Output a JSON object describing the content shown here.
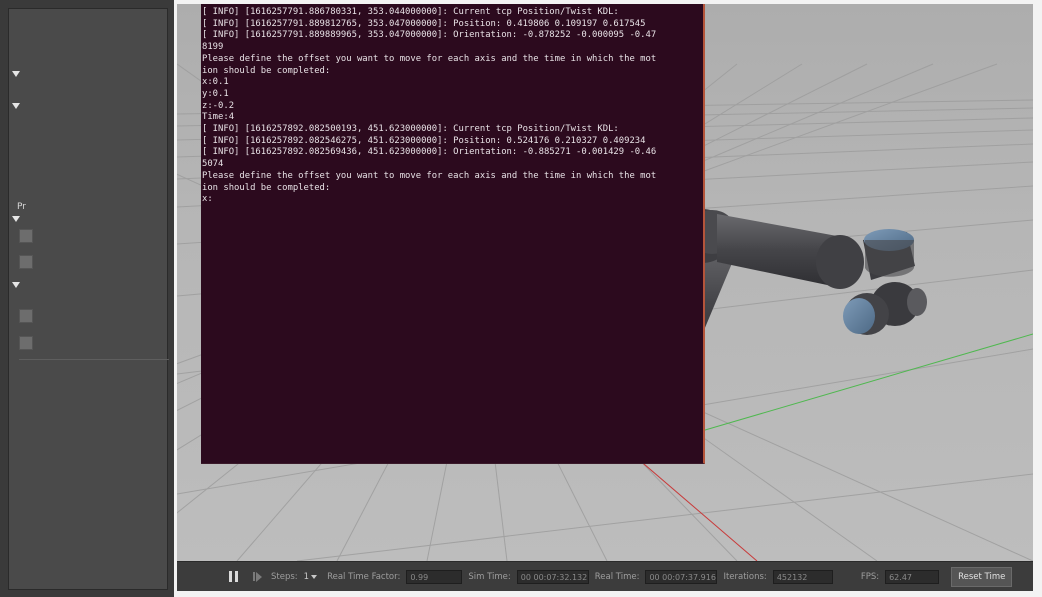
{
  "terminal": {
    "lines": [
      "[ INFO] [1616257791.886780331, 353.044000000]: Current tcp Position/Twist KDL:",
      "[ INFO] [1616257791.889812765, 353.047000000]: Position: 0.419806 0.109197 0.617545",
      "[ INFO] [1616257791.889889965, 353.047000000]: Orientation: -0.878252 -0.000095 -0.47",
      "8199",
      "Please define the offset you want to move for each axis and the time in which the mot",
      "ion should be completed:",
      "x:0.1",
      "y:0.1",
      "z:-0.2",
      "Time:4",
      "[ INFO] [1616257892.082500193, 451.623000000]: Current tcp Position/Twist KDL:",
      "[ INFO] [1616257892.082546275, 451.623000000]: Position: 0.524176 0.210327 0.409234",
      "[ INFO] [1616257892.082569436, 451.623000000]: Orientation: -0.885271 -0.001429 -0.46",
      "5074",
      "Please define the offset you want to move for each axis and the time in which the mot",
      "ion should be completed:",
      "x:"
    ]
  },
  "left_panel": {
    "label": "Pr"
  },
  "toolbar": {
    "steps_label": "Steps:",
    "steps_value": "1",
    "real_time_factor_label": "Real Time Factor:",
    "real_time_factor_value": "0.99",
    "sim_time_label": "Sim Time:",
    "sim_time_value": "00 00:07:32.132",
    "real_time_label": "Real Time:",
    "real_time_value": "00 00:07:37.916",
    "iterations_label": "Iterations:",
    "iterations_value": "452132",
    "fps_label": "FPS:",
    "fps_value": "62.47",
    "reset_button": "Reset Time"
  },
  "colors": {
    "terminal_bg": "#2c0a1e",
    "terminal_border": "#b5543a",
    "viewport_bg": "#b6b6b6",
    "robot_body": "#4a4a4e",
    "robot_caps": "#5b7a99",
    "z_axis": "#3b4cd6",
    "x_axis": "#c83a3a",
    "y_axis": "#3ab83a"
  }
}
